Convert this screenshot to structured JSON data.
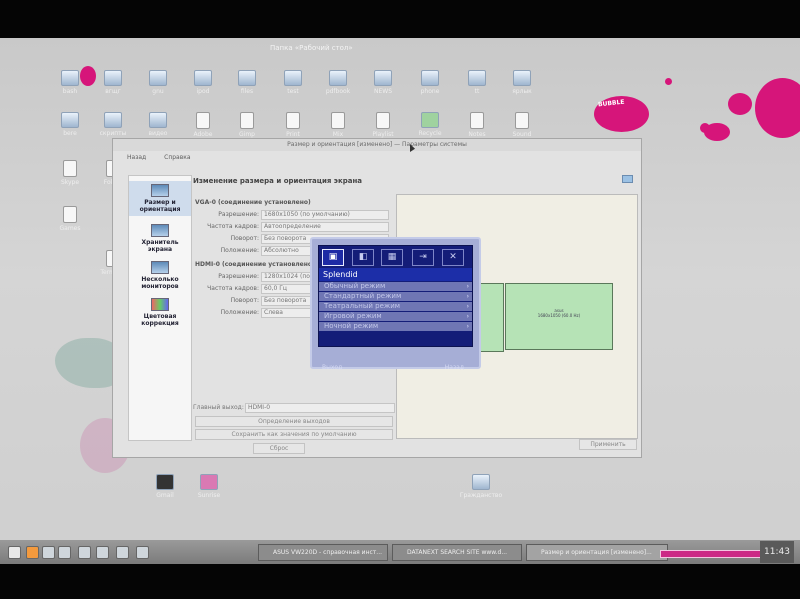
{
  "desktop": {
    "folder_title": "Папка «Рабочий стол»",
    "decor_text": "BUBBLE",
    "icons": [
      {
        "label": "bash"
      },
      {
        "label": "вгщг"
      },
      {
        "label": "gnu"
      },
      {
        "label": "ipod"
      },
      {
        "label": "files"
      },
      {
        "label": "test"
      },
      {
        "label": "pdfbook"
      },
      {
        "label": "NEWS"
      },
      {
        "label": "phone"
      },
      {
        "label": "tt"
      },
      {
        "label": "ярлык"
      },
      {
        "label": "bere"
      },
      {
        "label": "скрипты"
      },
      {
        "label": "видео"
      },
      {
        "label": "Adobe"
      },
      {
        "label": "Gimp"
      },
      {
        "label": "Print"
      },
      {
        "label": "Mix"
      },
      {
        "label": "Playlist"
      },
      {
        "label": "Recycle"
      },
      {
        "label": "Notes"
      },
      {
        "label": "Sound"
      },
      {
        "label": "Skype"
      },
      {
        "label": "Folder"
      },
      {
        "label": "Games"
      },
      {
        "label": "Terminal"
      },
      {
        "label": "Gmail"
      },
      {
        "label": "Sunrise"
      },
      {
        "label": "Гражданство"
      }
    ]
  },
  "window": {
    "title": "Размер и ориентация [изменено] — Параметры системы",
    "toolbar": {
      "back": "Назад",
      "help": "Справка"
    },
    "section_title": "Изменение размера и ориентация экрана",
    "sidebar": [
      {
        "label": "Размер и ориентация",
        "icon": "monitor-icon"
      },
      {
        "label": "Хранитель экрана",
        "icon": "screensaver-icon"
      },
      {
        "label": "Несколько мониторов",
        "icon": "monitors-icon"
      },
      {
        "label": "Цветовая коррекция",
        "icon": "color-icon"
      }
    ],
    "vga": {
      "group": "VGA-0 (соединение установлено)",
      "resolution_label": "Разрешение:",
      "resolution": "1680x1050 (по умолчанию)",
      "rate_label": "Частота кадров:",
      "rate": "Автоопределение",
      "rotation_label": "Поворот:",
      "rotation": "Без поворота",
      "position_label": "Положение:",
      "position": "Абсолютно"
    },
    "hdmi": {
      "group": "HDMI-0 (соединение установлено)",
      "resolution_label": "Разрешение:",
      "resolution": "1280x1024 (по",
      "rate_label": "Частота кадров:",
      "rate": "60,0 Гц",
      "rotation_label": "Поворот:",
      "rotation": "Без поворота",
      "position_label": "Положение:",
      "position": "Слева"
    },
    "primary_label": "Главный выход:",
    "primary": "HDMI-0",
    "identify_button": "Определение выходов",
    "save_defaults_button": "Сохранить как значения по умолчанию",
    "reset_button": "Сброс",
    "apply_button": "Применить",
    "preview_monitor_text": "asus\n1680x1050 (60.0 Hz)"
  },
  "osd": {
    "header": "Splendid",
    "items": [
      "Обычный режим",
      "Стандартный режим",
      "Театральный режим",
      "Игровой режим",
      "Ночной режим"
    ],
    "tabs": [
      "splendid-icon",
      "image-icon",
      "color-icon",
      "input-icon",
      "setup-icon"
    ],
    "footer_left": "Выход",
    "footer_right": "Назад"
  },
  "taskbar": {
    "tasks": [
      {
        "label": "ASUS VW220D - справочная инст..."
      },
      {
        "label": "DATANEXT SEARCH SITE www.d..."
      },
      {
        "label": "Размер и ориентация [изменено]..."
      }
    ],
    "clock": "11:43"
  }
}
